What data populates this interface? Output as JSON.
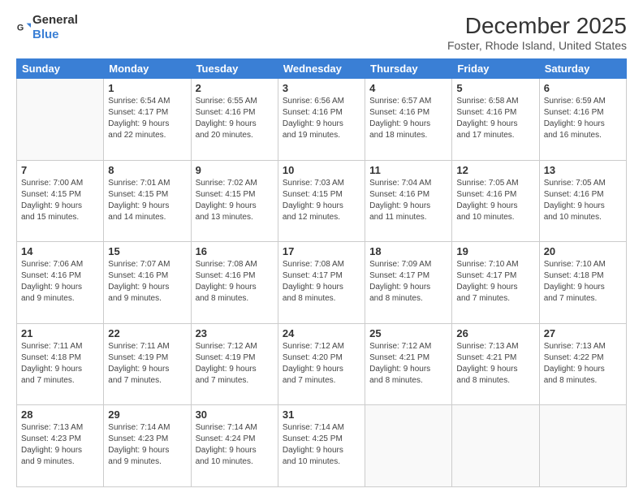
{
  "header": {
    "logo_general": "General",
    "logo_blue": "Blue",
    "month_title": "December 2025",
    "location": "Foster, Rhode Island, United States"
  },
  "days_of_week": [
    "Sunday",
    "Monday",
    "Tuesday",
    "Wednesday",
    "Thursday",
    "Friday",
    "Saturday"
  ],
  "weeks": [
    [
      {
        "day": "",
        "info": ""
      },
      {
        "day": "1",
        "info": "Sunrise: 6:54 AM\nSunset: 4:17 PM\nDaylight: 9 hours\nand 22 minutes."
      },
      {
        "day": "2",
        "info": "Sunrise: 6:55 AM\nSunset: 4:16 PM\nDaylight: 9 hours\nand 20 minutes."
      },
      {
        "day": "3",
        "info": "Sunrise: 6:56 AM\nSunset: 4:16 PM\nDaylight: 9 hours\nand 19 minutes."
      },
      {
        "day": "4",
        "info": "Sunrise: 6:57 AM\nSunset: 4:16 PM\nDaylight: 9 hours\nand 18 minutes."
      },
      {
        "day": "5",
        "info": "Sunrise: 6:58 AM\nSunset: 4:16 PM\nDaylight: 9 hours\nand 17 minutes."
      },
      {
        "day": "6",
        "info": "Sunrise: 6:59 AM\nSunset: 4:16 PM\nDaylight: 9 hours\nand 16 minutes."
      }
    ],
    [
      {
        "day": "7",
        "info": "Sunrise: 7:00 AM\nSunset: 4:15 PM\nDaylight: 9 hours\nand 15 minutes."
      },
      {
        "day": "8",
        "info": "Sunrise: 7:01 AM\nSunset: 4:15 PM\nDaylight: 9 hours\nand 14 minutes."
      },
      {
        "day": "9",
        "info": "Sunrise: 7:02 AM\nSunset: 4:15 PM\nDaylight: 9 hours\nand 13 minutes."
      },
      {
        "day": "10",
        "info": "Sunrise: 7:03 AM\nSunset: 4:15 PM\nDaylight: 9 hours\nand 12 minutes."
      },
      {
        "day": "11",
        "info": "Sunrise: 7:04 AM\nSunset: 4:16 PM\nDaylight: 9 hours\nand 11 minutes."
      },
      {
        "day": "12",
        "info": "Sunrise: 7:05 AM\nSunset: 4:16 PM\nDaylight: 9 hours\nand 10 minutes."
      },
      {
        "day": "13",
        "info": "Sunrise: 7:05 AM\nSunset: 4:16 PM\nDaylight: 9 hours\nand 10 minutes."
      }
    ],
    [
      {
        "day": "14",
        "info": "Sunrise: 7:06 AM\nSunset: 4:16 PM\nDaylight: 9 hours\nand 9 minutes."
      },
      {
        "day": "15",
        "info": "Sunrise: 7:07 AM\nSunset: 4:16 PM\nDaylight: 9 hours\nand 9 minutes."
      },
      {
        "day": "16",
        "info": "Sunrise: 7:08 AM\nSunset: 4:16 PM\nDaylight: 9 hours\nand 8 minutes."
      },
      {
        "day": "17",
        "info": "Sunrise: 7:08 AM\nSunset: 4:17 PM\nDaylight: 9 hours\nand 8 minutes."
      },
      {
        "day": "18",
        "info": "Sunrise: 7:09 AM\nSunset: 4:17 PM\nDaylight: 9 hours\nand 8 minutes."
      },
      {
        "day": "19",
        "info": "Sunrise: 7:10 AM\nSunset: 4:17 PM\nDaylight: 9 hours\nand 7 minutes."
      },
      {
        "day": "20",
        "info": "Sunrise: 7:10 AM\nSunset: 4:18 PM\nDaylight: 9 hours\nand 7 minutes."
      }
    ],
    [
      {
        "day": "21",
        "info": "Sunrise: 7:11 AM\nSunset: 4:18 PM\nDaylight: 9 hours\nand 7 minutes."
      },
      {
        "day": "22",
        "info": "Sunrise: 7:11 AM\nSunset: 4:19 PM\nDaylight: 9 hours\nand 7 minutes."
      },
      {
        "day": "23",
        "info": "Sunrise: 7:12 AM\nSunset: 4:19 PM\nDaylight: 9 hours\nand 7 minutes."
      },
      {
        "day": "24",
        "info": "Sunrise: 7:12 AM\nSunset: 4:20 PM\nDaylight: 9 hours\nand 7 minutes."
      },
      {
        "day": "25",
        "info": "Sunrise: 7:12 AM\nSunset: 4:21 PM\nDaylight: 9 hours\nand 8 minutes."
      },
      {
        "day": "26",
        "info": "Sunrise: 7:13 AM\nSunset: 4:21 PM\nDaylight: 9 hours\nand 8 minutes."
      },
      {
        "day": "27",
        "info": "Sunrise: 7:13 AM\nSunset: 4:22 PM\nDaylight: 9 hours\nand 8 minutes."
      }
    ],
    [
      {
        "day": "28",
        "info": "Sunrise: 7:13 AM\nSunset: 4:23 PM\nDaylight: 9 hours\nand 9 minutes."
      },
      {
        "day": "29",
        "info": "Sunrise: 7:14 AM\nSunset: 4:23 PM\nDaylight: 9 hours\nand 9 minutes."
      },
      {
        "day": "30",
        "info": "Sunrise: 7:14 AM\nSunset: 4:24 PM\nDaylight: 9 hours\nand 10 minutes."
      },
      {
        "day": "31",
        "info": "Sunrise: 7:14 AM\nSunset: 4:25 PM\nDaylight: 9 hours\nand 10 minutes."
      },
      {
        "day": "",
        "info": ""
      },
      {
        "day": "",
        "info": ""
      },
      {
        "day": "",
        "info": ""
      }
    ]
  ]
}
